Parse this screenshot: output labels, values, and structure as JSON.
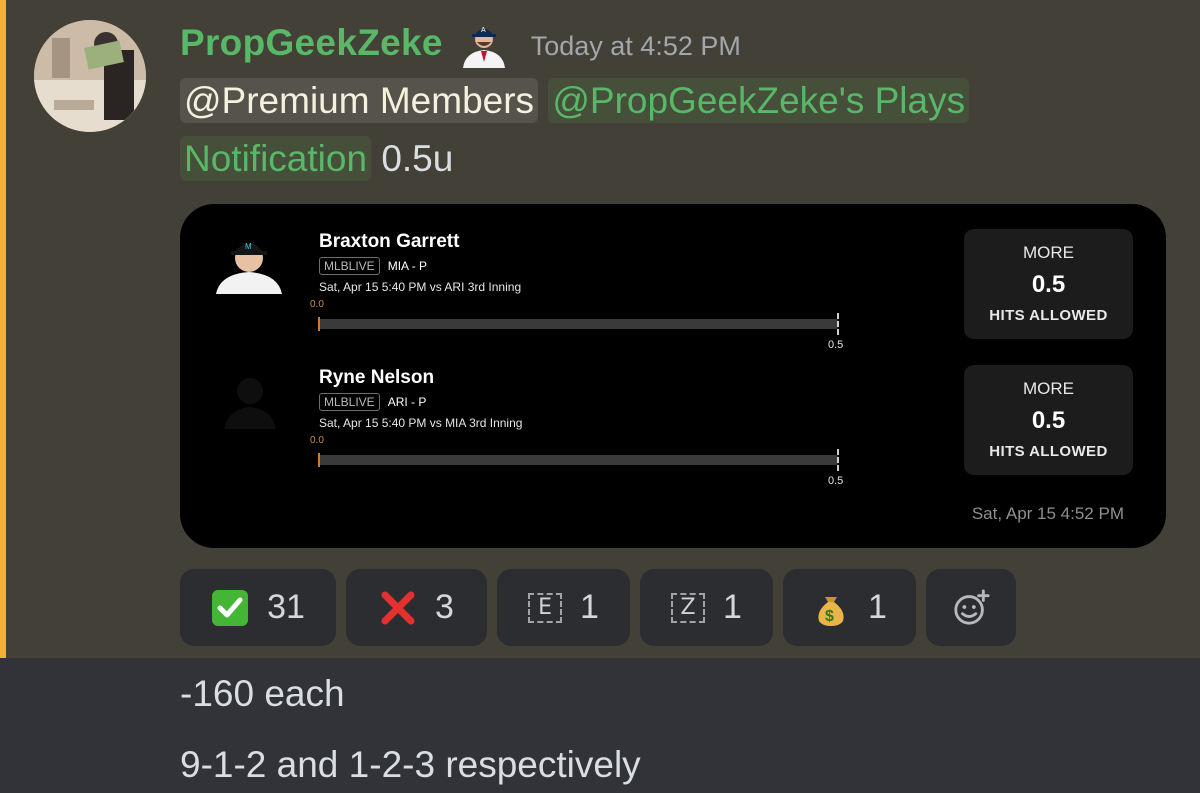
{
  "message": {
    "username": "PropGeekZeke",
    "timestamp": "Today at 4:52 PM",
    "mention_premium": "@Premium Members",
    "mention_plays_line1": "@PropGeekZeke's Plays",
    "mention_plays_line2": "Notification",
    "units": "0.5u"
  },
  "card": {
    "players": [
      {
        "name": "Braxton Garrett",
        "tag": "MLBLIVE",
        "team_pos": "MIA - P",
        "game": "Sat, Apr 15 5:40 PM  vs ARI 3rd Inning",
        "progress_start": "0.0",
        "progress_end": "0.5",
        "progress_value": 0,
        "pick_dir": "MORE",
        "pick_line": "0.5",
        "pick_stat": "HITS ALLOWED"
      },
      {
        "name": "Ryne Nelson",
        "tag": "MLBLIVE",
        "team_pos": "ARI - P",
        "game": "Sat, Apr 15 5:40 PM  vs MIA 3rd Inning",
        "progress_start": "0.0",
        "progress_end": "0.5",
        "progress_value": 0,
        "pick_dir": "MORE",
        "pick_line": "0.5",
        "pick_stat": "HITS ALLOWED"
      }
    ],
    "timestamp": "Sat, Apr 15 4:52 PM"
  },
  "reactions": [
    {
      "emoji": "check-mark-icon",
      "count": "31"
    },
    {
      "emoji": "cross-mark-icon",
      "count": "3"
    },
    {
      "emoji": "letter-e-icon",
      "letter": "E",
      "count": "1"
    },
    {
      "emoji": "letter-z-icon",
      "letter": "Z",
      "count": "1"
    },
    {
      "emoji": "money-bag-icon",
      "count": "1"
    }
  ],
  "followups": [
    "-160 each",
    "9-1-2 and 1-2-3 respectively"
  ]
}
